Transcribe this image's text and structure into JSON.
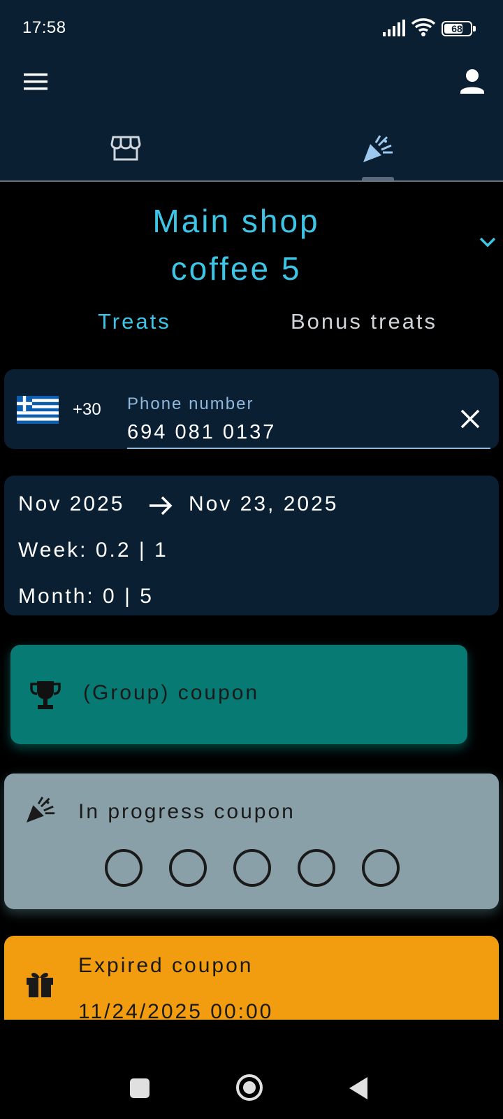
{
  "status_bar": {
    "time": "17:58",
    "battery": "68"
  },
  "top_tabs": [
    {
      "icon": "store-icon",
      "active": false
    },
    {
      "icon": "party-popper-icon",
      "active": true
    }
  ],
  "shop": {
    "line1": "Main shop",
    "line2": "coffee 5"
  },
  "subtabs": {
    "treats": "Treats",
    "bonus": "Bonus treats"
  },
  "phone": {
    "country_flag": "greece-flag-icon",
    "dial_code": "+30",
    "label": "Phone number",
    "value": "694 081 0137"
  },
  "stats": {
    "from": "Nov 2025",
    "to": "Nov 23, 2025",
    "week": "Week:  0.2  |  1",
    "month": "Month:  0  |  5"
  },
  "coupons": {
    "group": {
      "label": "(Group) coupon",
      "color": "#067a73"
    },
    "in_progress": {
      "label": "In progress coupon",
      "stamps_filled": 0,
      "stamps_total": 5,
      "color": "#8aa0a8"
    },
    "expired": {
      "label": "Expired coupon",
      "date": "11/24/2025 00:00",
      "color": "#f29c10"
    }
  },
  "colors": {
    "accent": "#3ec5e6",
    "topbar": "#0b1f33"
  }
}
